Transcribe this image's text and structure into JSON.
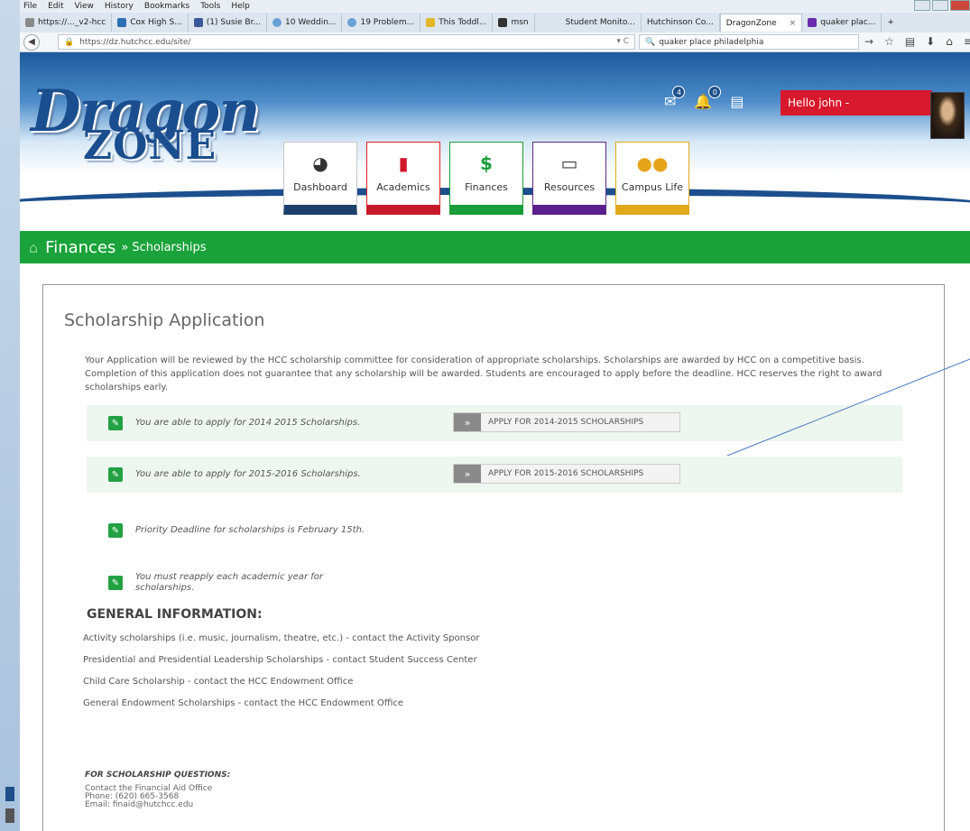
{
  "browser": {
    "menu": [
      "File",
      "Edit",
      "View",
      "History",
      "Bookmarks",
      "Tools",
      "Help"
    ],
    "tabs": [
      {
        "label": "https://..._v2-hcc",
        "icon_color": "#8a8a8a"
      },
      {
        "label": "Cox High S...",
        "icon_color": "#2d6fb5"
      },
      {
        "label": "(1) Susie Br...",
        "icon_color": "#3b5998"
      },
      {
        "label": "10 Weddin...",
        "icon_color": "#6aa0d8"
      },
      {
        "label": "19 Problem...",
        "icon_color": "#6aa0d8"
      },
      {
        "label": "This Toddl...",
        "icon_color": "#e1b72a"
      },
      {
        "label": "msn",
        "icon_color": "#333333"
      },
      {
        "label": "Student Monito...",
        "icon_color": "#ffffff"
      },
      {
        "label": "Hutchinson Co...",
        "icon_color": "#ffffff"
      },
      {
        "label": "DragonZone",
        "icon_color": "#ffffff",
        "active": true
      },
      {
        "label": "quaker plac...",
        "icon_color": "#6a2bb0"
      }
    ],
    "url": "https://dz.hutchcc.edu/site/",
    "search": "quaker place philadelphia"
  },
  "header": {
    "logo_top": "Dragon",
    "logo_bottom": "ZONE",
    "nav": [
      {
        "label": "Dashboard",
        "icon": "dashboard-icon"
      },
      {
        "label": "Academics",
        "icon": "book-icon"
      },
      {
        "label": "Finances",
        "icon": "dollar-icon"
      },
      {
        "label": "Resources",
        "icon": "laptop-icon"
      },
      {
        "label": "Campus Life",
        "icon": "users-icon"
      }
    ],
    "mail_count": "4",
    "bell_count": "0",
    "user_greeting": "Hello john -"
  },
  "breadcrumb": {
    "section": "Finances",
    "separator": "»",
    "page": "Scholarships"
  },
  "content": {
    "title": "Scholarship Application",
    "intro": "Your Application will be reviewed by the HCC scholarship committee for consideration of appropriate scholarships. Scholarships are awarded by HCC on a competitive basis. Completion of this application does not guarantee that any scholarship will be awarded. Students are encouraged to apply before the deadline. HCC reserves the right to award scholarships early.",
    "rows": [
      {
        "text": "You are able to apply for 2014 2015 Scholarships.",
        "button": "APPLY FOR 2014-2015 SCHOLARSHIPS"
      },
      {
        "text": "You are able to apply for 2015-2016 Scholarships.",
        "button": "APPLY FOR 2015-2016 SCHOLARSHIPS"
      },
      {
        "text": "Priority Deadline for scholarships is February 15th."
      },
      {
        "text": "You must reapply each academic year for scholarships."
      }
    ],
    "general_heading": "GENERAL INFORMATION:",
    "general_items": [
      "Activity scholarships (i.e. music, journalism, theatre, etc.) - contact the Activity Sponsor",
      "Presidential and Presidential Leadership Scholarships - contact Student Success Center",
      "Child Care Scholarship - contact the HCC Endowment Office",
      "General Endowment Scholarships - contact the HCC Endowment Office"
    ],
    "questions_heading": "FOR SCHOLARSHIP QUESTIONS:",
    "questions_lines": [
      "Contact the Financial Aid Office",
      "Phone: (620) 665-3568",
      "Email: finaid@hutchcc.edu"
    ]
  },
  "colors": {
    "accent_green": "#1aa33a",
    "header_red": "#d8182c",
    "brand_blue": "#1a4e8e"
  }
}
